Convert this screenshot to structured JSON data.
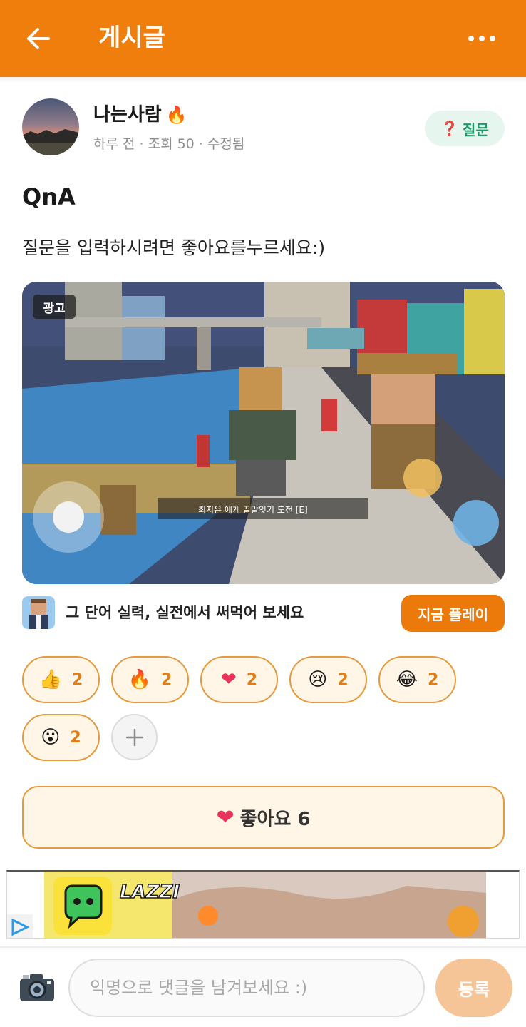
{
  "appbar": {
    "title": "게시글",
    "back_icon": "arrow-left-icon",
    "more_icon": "more-horizontal-icon"
  },
  "post": {
    "author": "나는사람",
    "author_badge_icon": "fire-icon",
    "meta": "하루 전 · 조회 50 · 수정됨",
    "category": {
      "icon": "question-icon",
      "label": "질문"
    },
    "title": "QnA",
    "body": "질문을 입력하시려면 좋아요를누르세요:)"
  },
  "ad": {
    "label": "광고",
    "caption": "최지은 에게 끝말잇기 도전 [E]",
    "text": "그 단어 실력, 실전에서 써먹어 보세요",
    "cta": "지금 플레이"
  },
  "reactions": [
    {
      "icon": "thumbs-up-icon",
      "emoji": "👍",
      "count": "2"
    },
    {
      "icon": "fire-icon",
      "emoji": "🔥",
      "count": "2"
    },
    {
      "icon": "heart-icon",
      "emoji": "❤",
      "count": "2"
    },
    {
      "icon": "crying-face-icon",
      "emoji": "😢",
      "count": "2"
    },
    {
      "icon": "laughing-face-icon",
      "emoji": "😂",
      "count": "2"
    },
    {
      "icon": "surprised-face-icon",
      "emoji": "😮",
      "count": "2"
    }
  ],
  "like_button": {
    "label": "좋아요 6",
    "icon": "heart-icon"
  },
  "banner": {
    "brand": "LAZZI"
  },
  "comment": {
    "placeholder": "익명으로 댓글을 남겨보세요 :)",
    "value": "",
    "submit": "등록",
    "camera_icon": "camera-icon"
  },
  "colors": {
    "accent": "#ef7e0c",
    "reaction_bg": "#fff6e8",
    "reaction_border": "#e69a3d",
    "badge_bg": "#e6f6ef",
    "badge_text": "#1e9a6a"
  }
}
